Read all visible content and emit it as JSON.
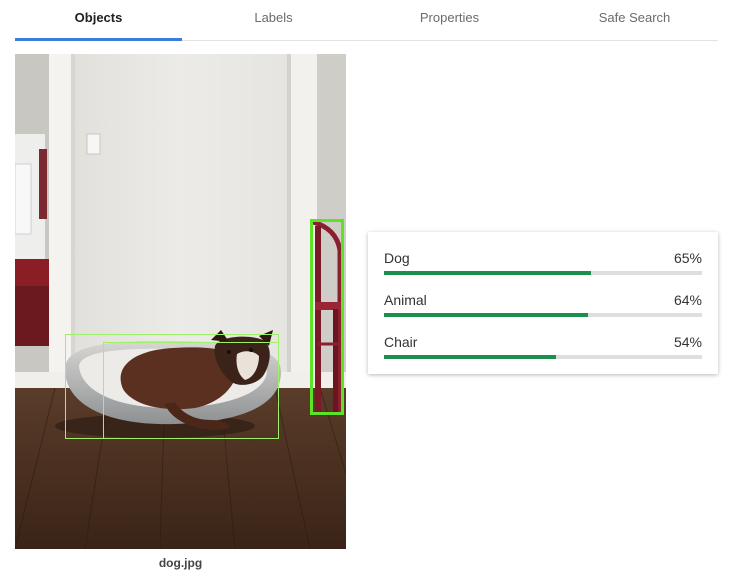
{
  "tabs": [
    {
      "label": "Objects",
      "active": true
    },
    {
      "label": "Labels",
      "active": false
    },
    {
      "label": "Properties",
      "active": false
    },
    {
      "label": "Safe Search",
      "active": false
    }
  ],
  "image": {
    "filename": "dog.jpg",
    "boxes": [
      {
        "label": "Dog",
        "selected": false
      },
      {
        "label": "Animal",
        "selected": false
      },
      {
        "label": "Chair",
        "selected": true
      }
    ]
  },
  "results": [
    {
      "name": "Dog",
      "score": "65%",
      "value": 0.65
    },
    {
      "name": "Animal",
      "score": "64%",
      "value": 0.64
    },
    {
      "name": "Chair",
      "score": "54%",
      "value": 0.54
    }
  ],
  "colors": {
    "accent_tab": "#3b7ddd",
    "bar_fill": "#1e8e4f",
    "bar_track": "#dedede",
    "box_outline": "#9ef06a",
    "box_selected": "#5ce325"
  }
}
